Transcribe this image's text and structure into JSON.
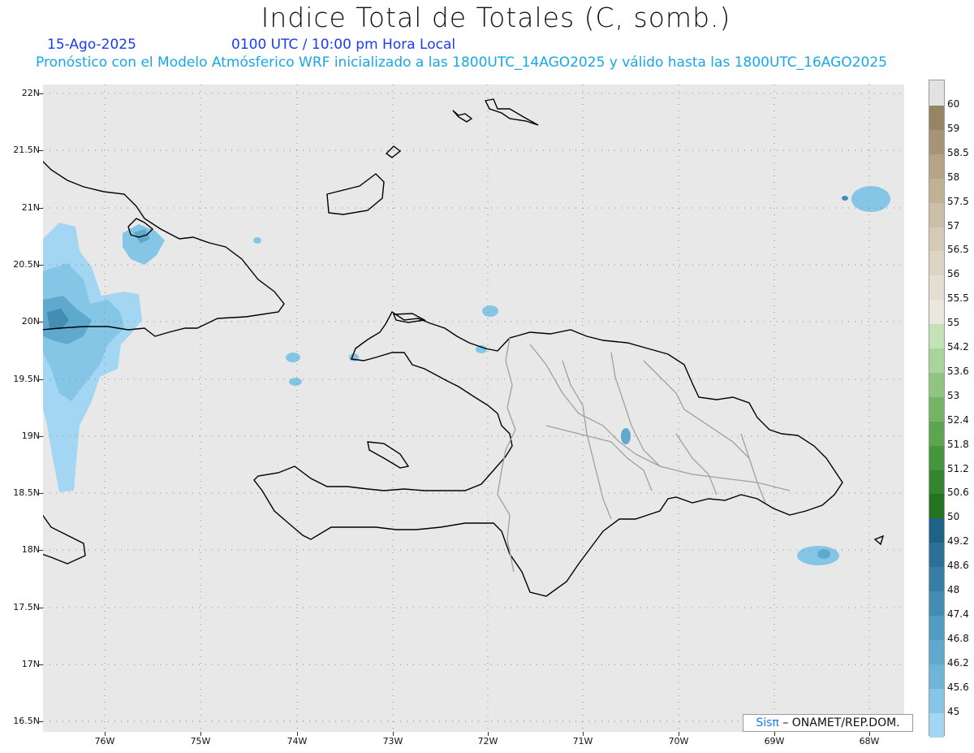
{
  "header": {
    "title": "Indice Total de Totales (C, somb.)",
    "date": "15-Ago-2025",
    "time": "0100 UTC / 10:00 pm Hora Local",
    "description": "Pronóstico con el Modelo Atmósferico WRF inicializado a las 1800UTC_14AGO2025 y válido hasta las  1800UTC_16AGO2025"
  },
  "map": {
    "lat_labels": [
      "22N",
      "21.5N",
      "21N",
      "20.5N",
      "20N",
      "19.5N",
      "19N",
      "18.5N",
      "18N",
      "17.5N",
      "17N",
      "16.5N"
    ],
    "lon_labels": [
      "76W",
      "75W",
      "74W",
      "73W",
      "72W",
      "71W",
      "70W",
      "69W",
      "68W"
    ],
    "background_color": "#e8e8e8",
    "border_color_countries": "#000000",
    "border_color_provinces": "#a0a0a0"
  },
  "credit": {
    "sis": "Sisπ",
    "text": " – ONAMET/REP.DOM."
  },
  "colorbar": {
    "levels": [
      {
        "label": "60",
        "color": "#978462"
      },
      {
        "label": "59",
        "color": "#a89374"
      },
      {
        "label": "58.5",
        "color": "#b6a485"
      },
      {
        "label": "58",
        "color": "#c1b296"
      },
      {
        "label": "57.5",
        "color": "#cbbfa7"
      },
      {
        "label": "57",
        "color": "#d4cab6"
      },
      {
        "label": "56.5",
        "color": "#dcd4c5"
      },
      {
        "label": "56",
        "color": "#e3ddd2"
      },
      {
        "label": "55.5",
        "color": "#ebe7de"
      },
      {
        "label": "55",
        "color": "#c4e2b7"
      },
      {
        "label": "54.2",
        "color": "#a9d59b"
      },
      {
        "label": "53.6",
        "color": "#8ec57f"
      },
      {
        "label": "53",
        "color": "#74b465"
      },
      {
        "label": "52.4",
        "color": "#5ca64f"
      },
      {
        "label": "51.8",
        "color": "#46963c"
      },
      {
        "label": "51.2",
        "color": "#33862d"
      },
      {
        "label": "50.6",
        "color": "#237420"
      },
      {
        "label": "50",
        "color": "#1f6287"
      },
      {
        "label": "49.2",
        "color": "#2a7098"
      },
      {
        "label": "48.6",
        "color": "#367ea6"
      },
      {
        "label": "48",
        "color": "#438db4"
      },
      {
        "label": "47.4",
        "color": "#519cc2"
      },
      {
        "label": "46.8",
        "color": "#5fa9ce"
      },
      {
        "label": "46.2",
        "color": "#6eb6d9"
      },
      {
        "label": "45.6",
        "color": "#85c5e6"
      },
      {
        "label": "45",
        "color": "#a3d6f2"
      }
    ],
    "top_color": "#e2e2e2",
    "bottom_color": "#e2e2e2"
  }
}
